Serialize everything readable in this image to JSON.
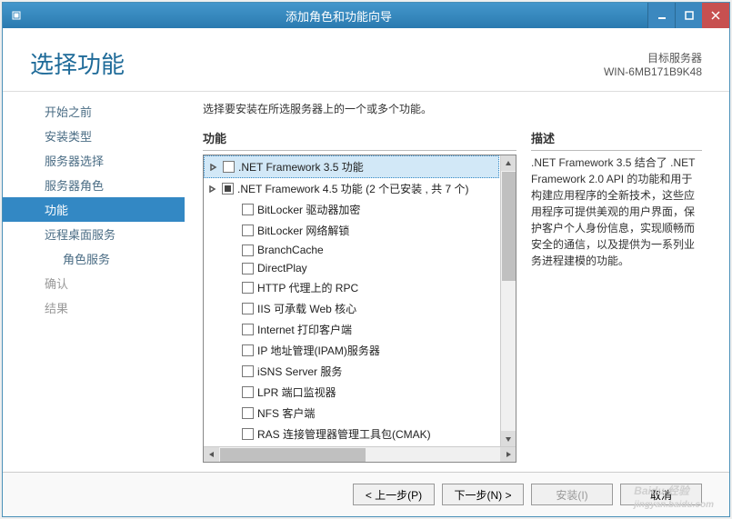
{
  "titlebar": {
    "title": "添加角色和功能向导"
  },
  "header": {
    "title": "选择功能",
    "target_label": "目标服务器",
    "target_value": "WIN-6MB171B9K48"
  },
  "sidebar": {
    "items": [
      {
        "label": "开始之前"
      },
      {
        "label": "安装类型"
      },
      {
        "label": "服务器选择"
      },
      {
        "label": "服务器角色"
      },
      {
        "label": "功能",
        "selected": true
      },
      {
        "label": "远程桌面服务"
      },
      {
        "label": "角色服务",
        "sub": true
      },
      {
        "label": "确认",
        "disabled": true
      },
      {
        "label": "结果",
        "disabled": true
      }
    ]
  },
  "main": {
    "instruction": "选择要安装在所选服务器上的一个或多个功能。",
    "features_title": "功能",
    "description_title": "描述",
    "description_text": ".NET Framework 3.5 结合了 .NET Framework 2.0 API 的功能和用于构建应用程序的全新技术，这些应用程序可提供美观的用户界面，保护客户个人身份信息，实现顺畅而安全的通信，以及提供为一系列业务进程建模的功能。",
    "features": [
      {
        "label": ".NET Framework 3.5 功能",
        "expandable": true,
        "open": false,
        "highlight": true,
        "hasCheck": true
      },
      {
        "label": ".NET Framework 4.5 功能 (2 个已安装 , 共 7 个)",
        "expandable": true,
        "open": false,
        "partial": true,
        "hasCheck": true
      },
      {
        "label": "BitLocker 驱动器加密",
        "hasCheck": true
      },
      {
        "label": "BitLocker 网络解锁",
        "hasCheck": true
      },
      {
        "label": "BranchCache",
        "hasCheck": true
      },
      {
        "label": "DirectPlay",
        "hasCheck": true
      },
      {
        "label": "HTTP 代理上的 RPC",
        "hasCheck": true
      },
      {
        "label": "IIS 可承载 Web 核心",
        "hasCheck": true
      },
      {
        "label": "Internet 打印客户端",
        "hasCheck": true
      },
      {
        "label": "IP 地址管理(IPAM)服务器",
        "hasCheck": true
      },
      {
        "label": "iSNS Server 服务",
        "hasCheck": true
      },
      {
        "label": "LPR 端口监视器",
        "hasCheck": true
      },
      {
        "label": "NFS 客户端",
        "hasCheck": true
      },
      {
        "label": "RAS 连接管理器管理工具包(CMAK)",
        "hasCheck": true
      }
    ]
  },
  "footer": {
    "prev": "< 上一步(P)",
    "next": "下一步(N) >",
    "install": "安装(I)",
    "cancel": "取消"
  },
  "watermark": {
    "brand": "Baidu 经验",
    "url": "jingyan.baidu.com"
  }
}
